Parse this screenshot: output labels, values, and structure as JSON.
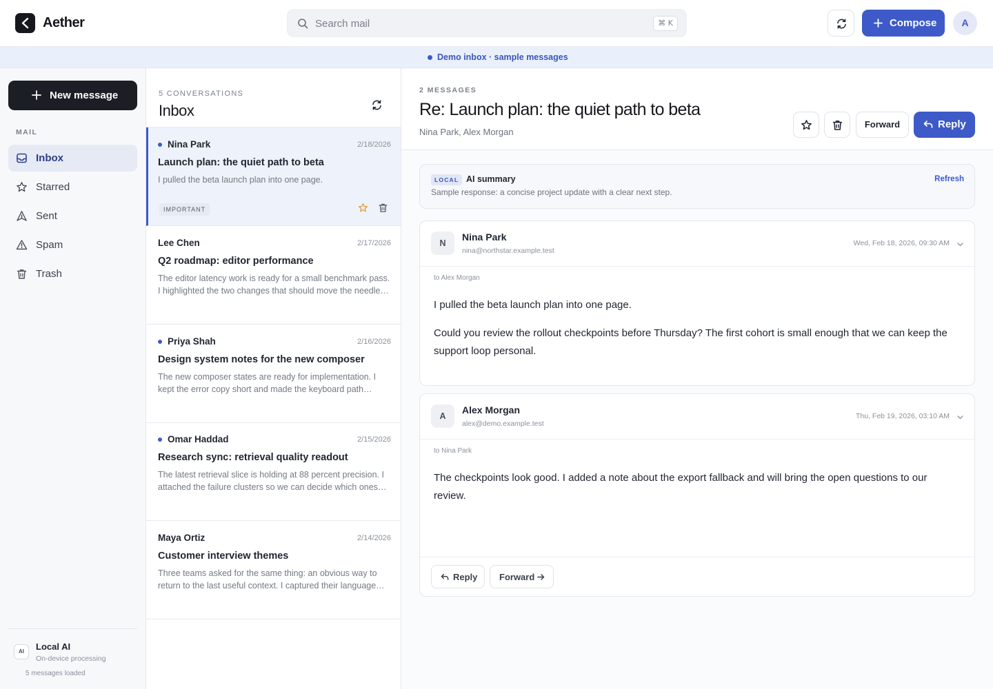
{
  "app": {
    "brand": "Aether"
  },
  "search": {
    "placeholder": "Search mail",
    "shortcut": "⌘ K"
  },
  "header": {
    "compose_label": "Compose",
    "avatar_initial": "A"
  },
  "banner": {
    "text": "Demo inbox · sample messages"
  },
  "sidebar": {
    "new_message_label": "New message",
    "section_label": "MAIL",
    "items": [
      {
        "label": "Inbox",
        "icon": "inbox-icon",
        "active": true
      },
      {
        "label": "Starred",
        "icon": "star-icon",
        "active": false
      },
      {
        "label": "Sent",
        "icon": "send-icon",
        "active": false
      },
      {
        "label": "Spam",
        "icon": "alert-icon",
        "active": false
      },
      {
        "label": "Trash",
        "icon": "trash-icon",
        "active": false
      }
    ],
    "ai": {
      "badge": "AI",
      "title": "Local AI",
      "subtitle": "On-device processing",
      "count": "5 messages loaded"
    }
  },
  "list": {
    "count_label": "5 CONVERSATIONS",
    "title": "Inbox",
    "conversations": [
      {
        "sender": "Nina Park",
        "date": "2/18/2026",
        "subject": "Launch plan: the quiet path to beta",
        "snippet": "I pulled the beta launch plan into one page.",
        "unread": true,
        "selected": true,
        "badge": "IMPORTANT"
      },
      {
        "sender": "Lee Chen",
        "date": "2/17/2026",
        "subject": "Q2 roadmap: editor performance",
        "snippet": "The editor latency work is ready for a small benchmark pass. I highlighted the two changes that should move the needle most.",
        "unread": false,
        "selected": false
      },
      {
        "sender": "Priya Shah",
        "date": "2/16/2026",
        "subject": "Design system notes for the new composer",
        "snippet": "The new composer states are ready for implementation. I kept the error copy short and made the keyboard path obvious.",
        "unread": true,
        "selected": false
      },
      {
        "sender": "Omar Haddad",
        "date": "2/15/2026",
        "subject": "Research sync: retrieval quality readout",
        "snippet": "The latest retrieval slice is holding at 88 percent precision. I attached the failure clusters so we can decide which ones matter.",
        "unread": true,
        "selected": false
      },
      {
        "sender": "Maya Ortiz",
        "date": "2/14/2026",
        "subject": "Customer interview themes",
        "snippet": "Three teams asked for the same thing: an obvious way to return to the last useful context. I captured their language verbatim.",
        "unread": false,
        "selected": false
      }
    ]
  },
  "thread": {
    "count_label": "2 MESSAGES",
    "title": "Re: Launch plan: the quiet path to beta",
    "participants": "Nina Park, Alex Morgan",
    "forward_label": "Forward",
    "reply_label": "Reply",
    "summary": {
      "tag": "LOCAL",
      "title": "AI summary",
      "text": "Sample response: a concise project update with a clear next step.",
      "refresh_label": "Refresh"
    },
    "messages": [
      {
        "initial": "N",
        "from": "Nina Park",
        "email": "nina@northstar.example.test",
        "date": "Wed, Feb 18, 2026, 09:30 AM",
        "to": "to Alex Morgan",
        "paragraphs": [
          "I pulled the beta launch plan into one page.",
          "Could you review the rollout checkpoints before Thursday? The first cohort is small enough that we can keep the support loop personal."
        ]
      },
      {
        "initial": "A",
        "from": "Alex Morgan",
        "email": "alex@demo.example.test",
        "date": "Thu, Feb 19, 2026, 03:10 AM",
        "to": "to Nina Park",
        "paragraphs": [
          "The checkpoints look good. I added a note about the export fallback and will bring the open questions to our review."
        ]
      }
    ],
    "footer": {
      "reply_label": "Reply",
      "forward_label": "Forward"
    }
  },
  "colors": {
    "accent": "#3d5ac8",
    "dark": "#1b1e25",
    "selected_bg": "#eef2fb",
    "banner_bg": "#eaf0fb"
  }
}
